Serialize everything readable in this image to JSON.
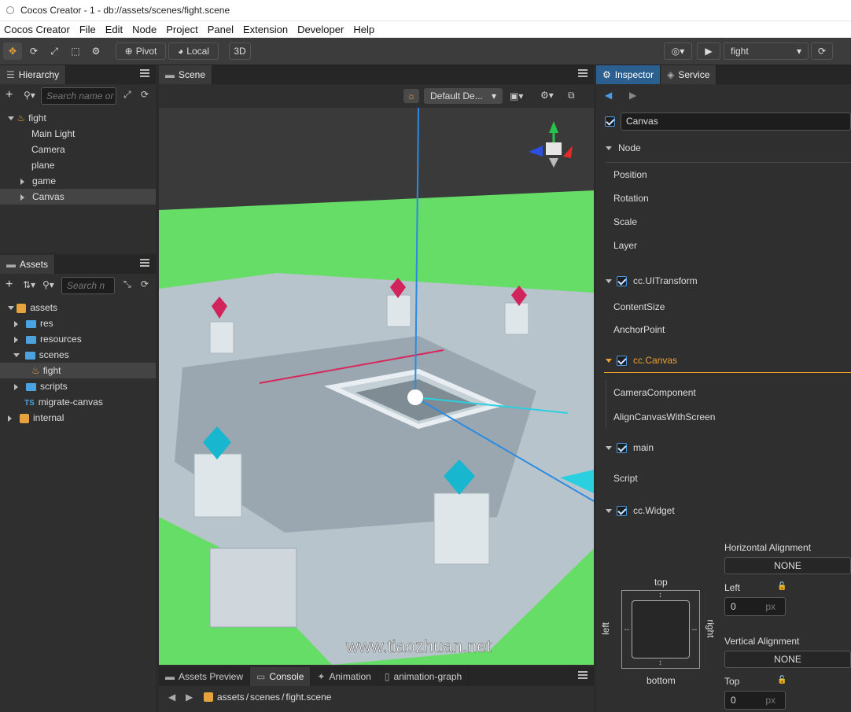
{
  "window": {
    "title": "Cocos Creator - 1 - db://assets/scenes/fight.scene"
  },
  "menu": [
    "Cocos Creator",
    "File",
    "Edit",
    "Node",
    "Project",
    "Panel",
    "Extension",
    "Developer",
    "Help"
  ],
  "toolbar": {
    "pivot_label": "Pivot",
    "local_label": "Local",
    "mode_3d_label": "3D",
    "scene_select": "fight"
  },
  "hierarchy": {
    "tab": "Hierarchy",
    "search_placeholder": "Search name or",
    "nodes": [
      {
        "label": "fight"
      },
      {
        "label": "Main Light"
      },
      {
        "label": "Camera"
      },
      {
        "label": "plane"
      },
      {
        "label": "game"
      },
      {
        "label": "Canvas"
      }
    ]
  },
  "assets": {
    "tab": "Assets",
    "search_placeholder": "Search n",
    "items": [
      {
        "label": "assets"
      },
      {
        "label": "res"
      },
      {
        "label": "resources"
      },
      {
        "label": "scenes"
      },
      {
        "label": "fight"
      },
      {
        "label": "scripts"
      },
      {
        "label": "migrate-canvas"
      },
      {
        "label": "internal"
      }
    ]
  },
  "scene": {
    "tab": "Scene",
    "layout_select": "Default De...",
    "watermark": "www.tiaozhuan.net"
  },
  "bottom": {
    "tabs": [
      "Assets Preview",
      "Console",
      "Animation",
      "animation-graph"
    ],
    "breadcrumb": [
      "assets",
      "/",
      "scenes",
      "/",
      "fight.scene"
    ]
  },
  "inspector": {
    "tabs": [
      "Inspector",
      "Service"
    ],
    "node_name": "Canvas",
    "node_section": "Node",
    "node_props": [
      "Position",
      "Rotation",
      "Scale",
      "Layer"
    ],
    "uitransform": {
      "title": "cc.UITransform",
      "props": [
        "ContentSize",
        "AnchorPoint"
      ]
    },
    "canvas": {
      "title": "cc.Canvas",
      "props": [
        "CameraComponent",
        "AlignCanvasWithScreen"
      ]
    },
    "main": {
      "title": "main",
      "props": [
        "Script"
      ]
    },
    "widget": {
      "title": "cc.Widget",
      "top": "top",
      "bottom": "bottom",
      "left": "left",
      "right": "right",
      "h_align_label": "Horizontal Alignment",
      "h_align_value": "NONE",
      "left_label": "Left",
      "left_value": "0",
      "left_unit": "px",
      "v_align_label": "Vertical Alignment",
      "v_align_value": "NONE",
      "top_label": "Top",
      "top_value": "0",
      "top_unit": "px"
    }
  }
}
